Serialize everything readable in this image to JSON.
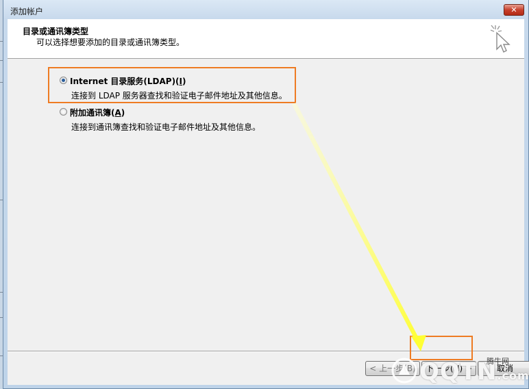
{
  "window": {
    "title": "添加帐户",
    "close_label": "✕"
  },
  "header": {
    "title": "目录或通讯簿类型",
    "subtitle": "可以选择想要添加的目录或通讯簿类型。"
  },
  "options": [
    {
      "label_main": "Internet 目录服务(LDAP)(",
      "label_key": "I",
      "label_end": ")",
      "description": "连接到 LDAP 服务器查找和验证电子邮件地址及其他信息。",
      "checked": true
    },
    {
      "label_main": "附加通讯簿(",
      "label_key": "A",
      "label_end": ")",
      "description": "连接到通讯簿查找和验证电子邮件地址及其他信息。",
      "checked": false
    }
  ],
  "buttons": {
    "prev_label": "< 上一步(B)",
    "next_label": "下一步(N) >",
    "cancel_label": "取消"
  },
  "watermark": {
    "logo_text": "QQTN",
    "suffix": ".com",
    "site_name": "腾牛网"
  },
  "colors": {
    "highlight": "#ee7b22",
    "arrow": "#ffff33",
    "titlebar": "#c7d9ec"
  }
}
